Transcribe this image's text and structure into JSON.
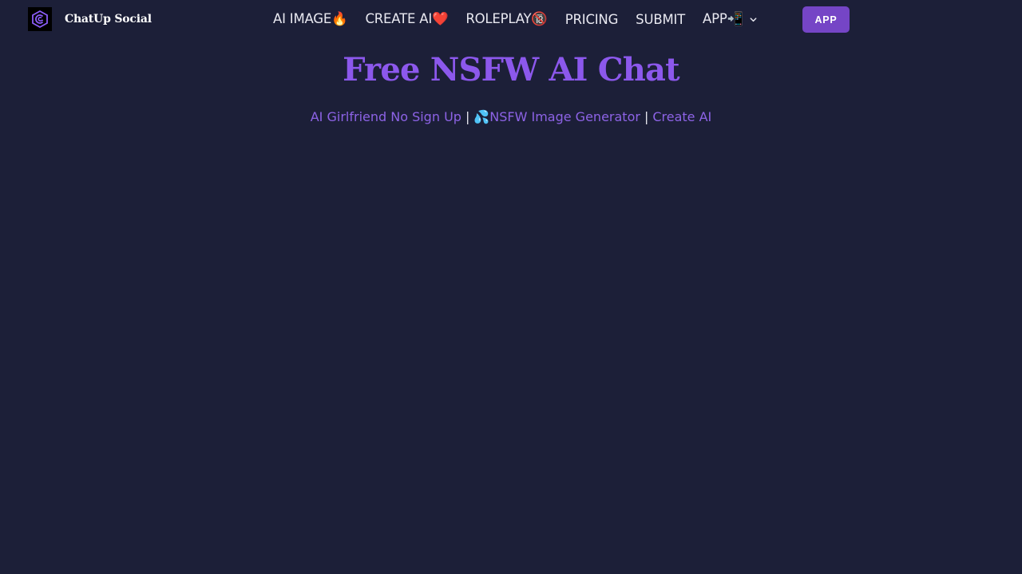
{
  "brand": {
    "name": "ChatUp Social"
  },
  "nav": {
    "items": [
      {
        "label": "AI IMAGE🔥"
      },
      {
        "label": "CREATE AI❤️"
      },
      {
        "label": "ROLEPLAY🔞"
      },
      {
        "label": "PRICING"
      },
      {
        "label": "SUBMIT"
      },
      {
        "label": "APP📲"
      }
    ],
    "app_button_label": "APP"
  },
  "hero": {
    "title": "Free NSFW AI Chat",
    "links": [
      {
        "label": "AI Girlfriend No Sign Up"
      },
      {
        "label": "💦NSFW Image Generator"
      },
      {
        "label": "Create AI"
      }
    ],
    "separator": "|"
  },
  "colors": {
    "background": "#1c1f38",
    "accent": "#8c58ec",
    "button": "#7545c6"
  }
}
